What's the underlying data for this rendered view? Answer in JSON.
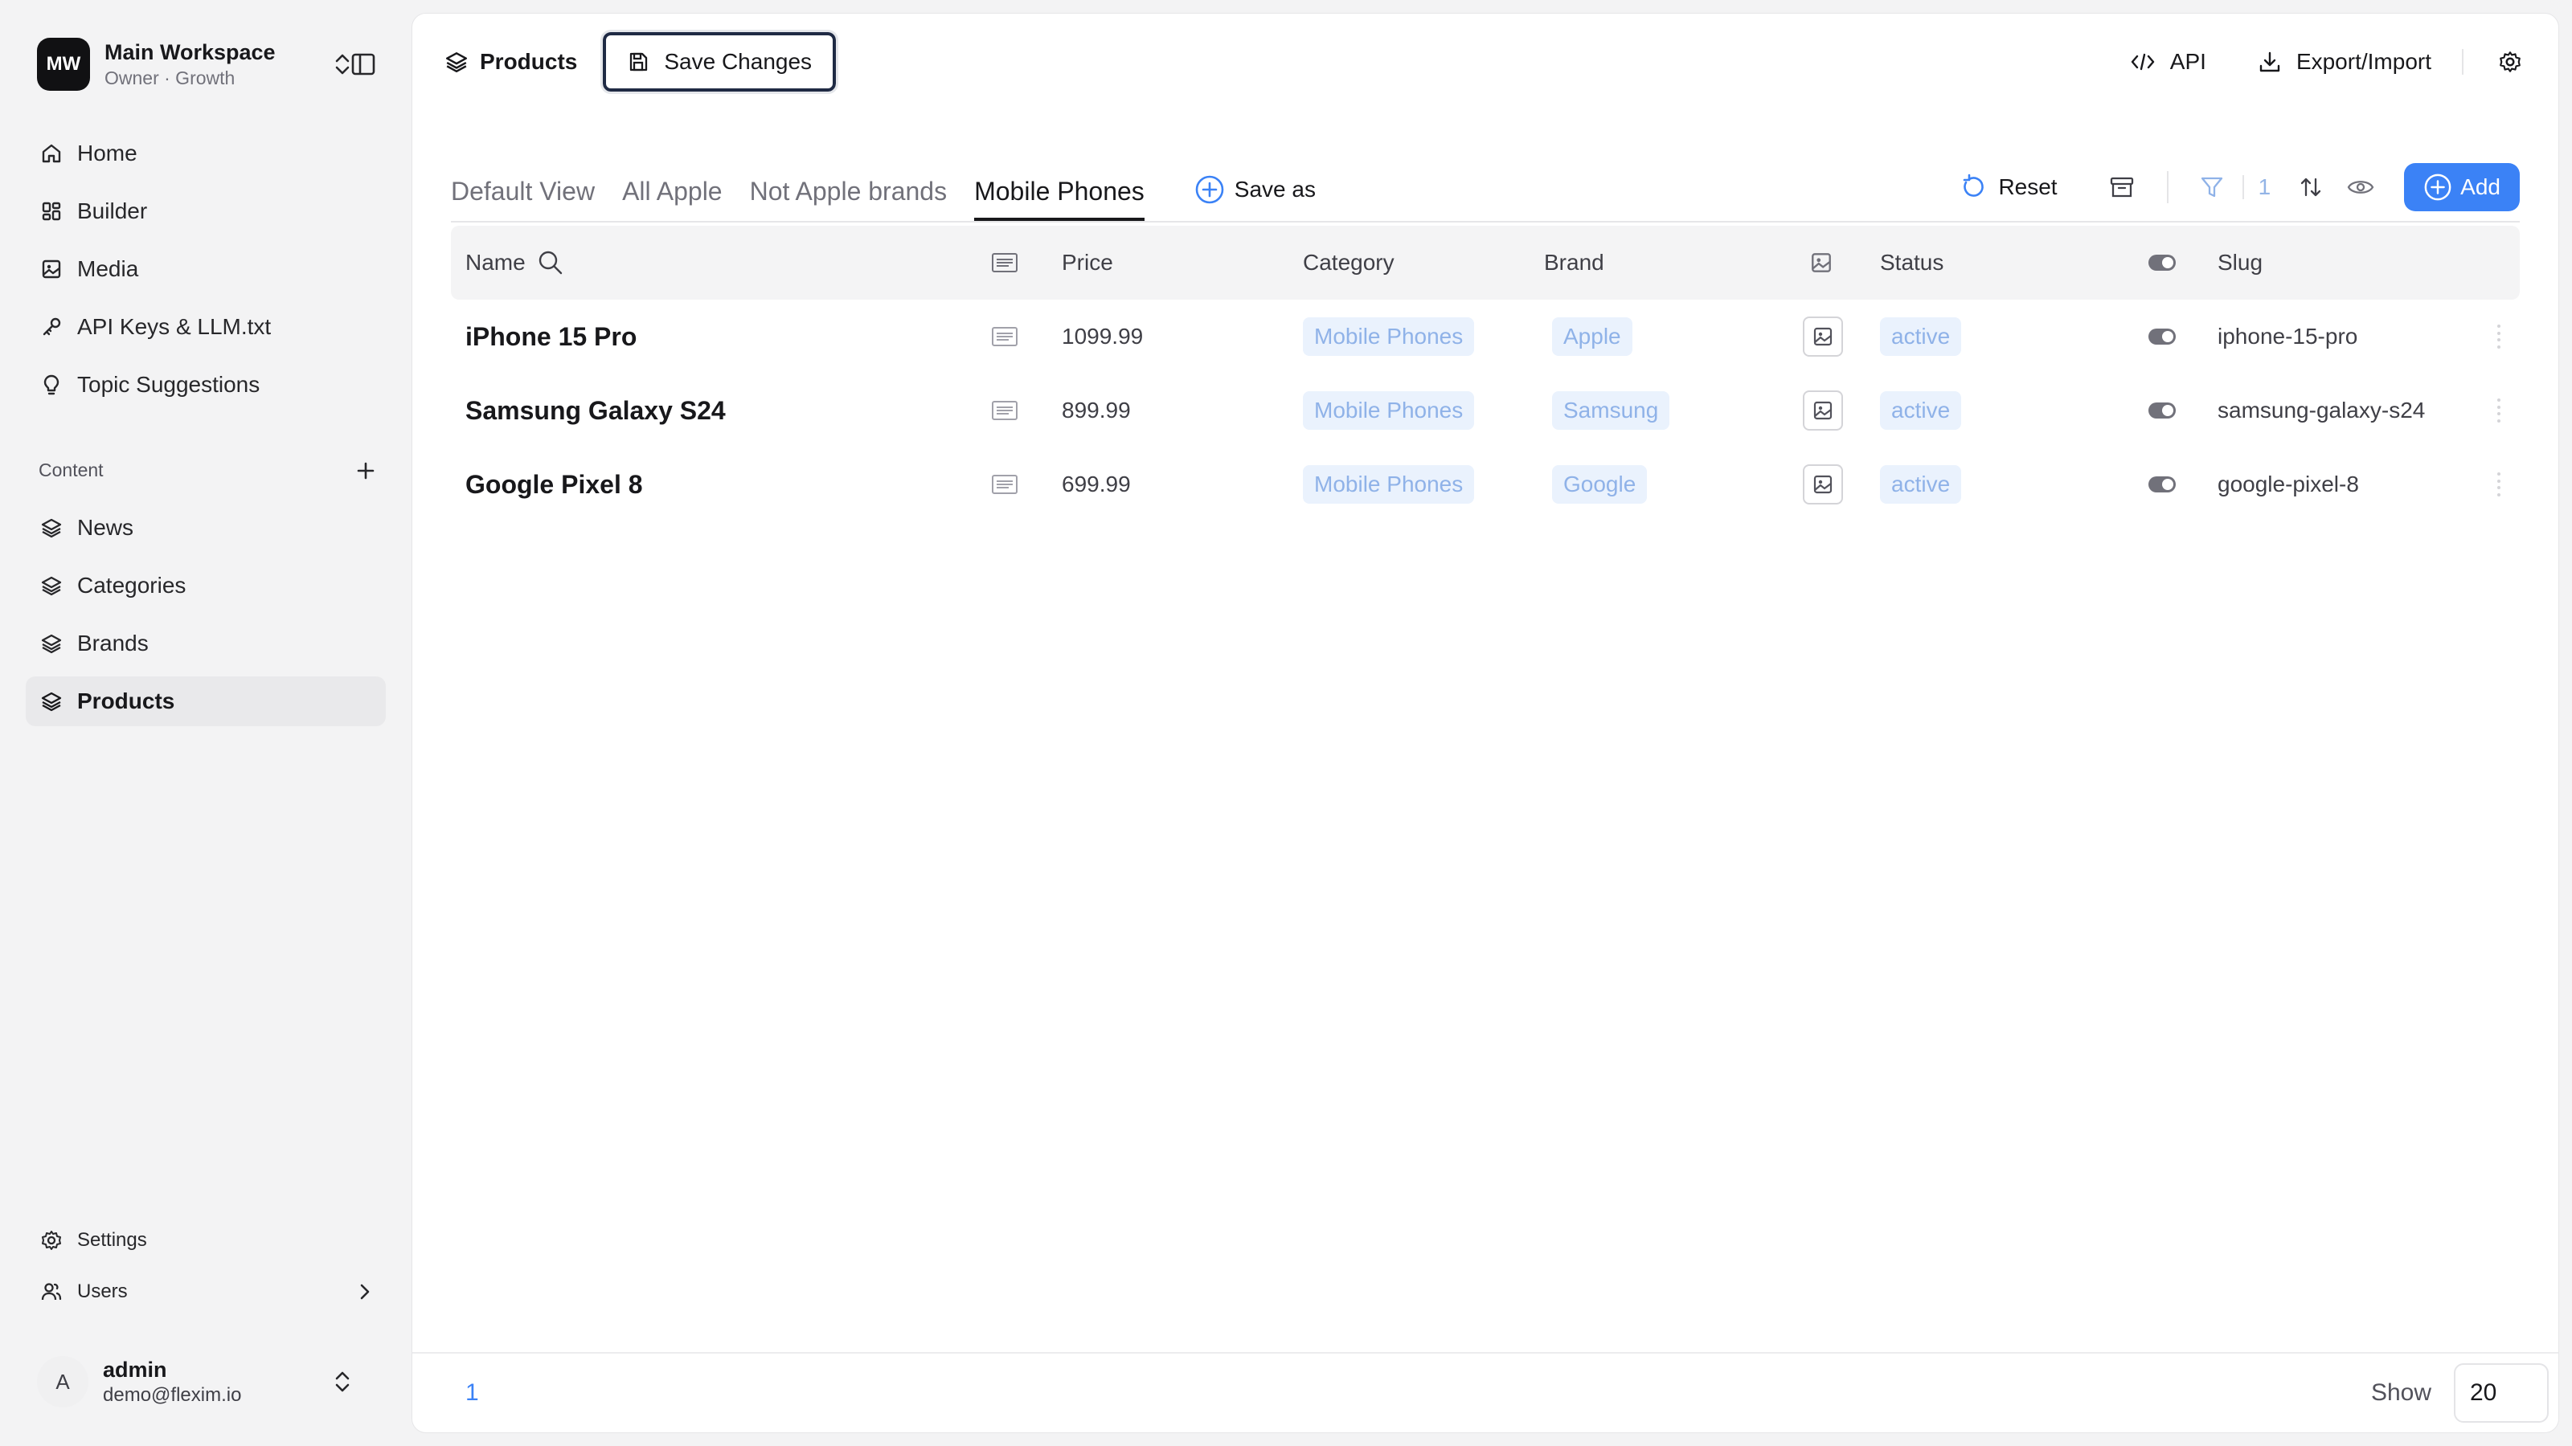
{
  "workspace": {
    "initials": "MW",
    "name": "Main Workspace",
    "plan": "Owner · Growth"
  },
  "sidebar": {
    "top_items": [
      {
        "label": "Home",
        "icon": "home-icon"
      },
      {
        "label": "Builder",
        "icon": "grid-icon"
      },
      {
        "label": "Media",
        "icon": "image-icon"
      },
      {
        "label": "API Keys & LLM.txt",
        "icon": "key-icon"
      },
      {
        "label": "Topic Suggestions",
        "icon": "lightbulb-icon"
      }
    ],
    "content_label": "Content",
    "content_items": [
      {
        "label": "News",
        "icon": "layers-icon"
      },
      {
        "label": "Categories",
        "icon": "layers-icon"
      },
      {
        "label": "Brands",
        "icon": "layers-icon"
      },
      {
        "label": "Products",
        "icon": "layers-icon",
        "active": true
      }
    ],
    "bottom_items": [
      {
        "label": "Settings",
        "icon": "gear-icon"
      },
      {
        "label": "Users",
        "icon": "users-icon"
      }
    ],
    "user": {
      "initial": "A",
      "name": "admin",
      "email": "demo@flexim.io"
    }
  },
  "toolbar": {
    "title": "Products",
    "save_label": "Save Changes",
    "api_label": "API",
    "export_label": "Export/Import"
  },
  "views": {
    "tabs": [
      "Default View",
      "All Apple",
      "Not Apple brands",
      "Mobile Phones"
    ],
    "active_tab": "Mobile Phones",
    "save_as_label": "Save as",
    "reset_label": "Reset",
    "filter_count": "1",
    "add_label": "Add"
  },
  "table": {
    "headers": {
      "name": "Name",
      "price": "Price",
      "category": "Category",
      "brand": "Brand",
      "status": "Status",
      "slug": "Slug"
    },
    "rows": [
      {
        "name": "iPhone 15 Pro",
        "price": "1099.99",
        "category": "Mobile Phones",
        "brand": "Apple",
        "status": "active",
        "slug": "iphone-15-pro"
      },
      {
        "name": "Samsung Galaxy S24",
        "price": "899.99",
        "category": "Mobile Phones",
        "brand": "Samsung",
        "status": "active",
        "slug": "samsung-galaxy-s24"
      },
      {
        "name": "Google Pixel 8",
        "price": "699.99",
        "category": "Mobile Phones",
        "brand": "Google",
        "status": "active",
        "slug": "google-pixel-8"
      }
    ]
  },
  "footer": {
    "page": "1",
    "show_label": "Show",
    "page_size": "20"
  },
  "colors": {
    "accent": "#3b82f6",
    "chip_bg": "#eaf2fd",
    "chip_text": "#8fb2e8"
  }
}
